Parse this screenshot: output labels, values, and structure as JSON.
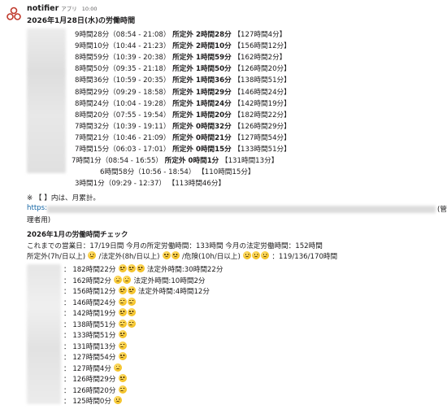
{
  "app": {
    "name": "notifier",
    "tag": "アプリ",
    "time": "10:00"
  },
  "message1": {
    "title": "2026年1月28日(水)の労働時間",
    "rows": [
      {
        "a": "9時間28分（08:54 - 21:08）",
        "b": "所定外 2時間28分",
        "c": "【127時間4分】"
      },
      {
        "a": "9時間10分（10:44 - 21:23）",
        "b": "所定外 2時間10分",
        "c": "【156時間12分】"
      },
      {
        "a": "8時間59分（10:39 - 20:38）",
        "b": "所定外 1時間59分",
        "c": "【162時間2分】"
      },
      {
        "a": "8時間50分（09:35 - 21:18）",
        "b": "所定外 1時間50分",
        "c": "【126時間20分】"
      },
      {
        "a": "8時間36分（10:59 - 20:35）",
        "b": "所定外 1時間36分",
        "c": "【138時間51分】"
      },
      {
        "a": "8時間29分（09:29 - 18:58）",
        "b": "所定外 1時間29分",
        "c": "【146時間24分】"
      },
      {
        "a": "8時間24分（10:04 - 19:28）",
        "b": "所定外 1時間24分",
        "c": "【142時間19分】"
      },
      {
        "a": "8時間20分（07:55 - 19:54）",
        "b": "所定外 1時間20分",
        "c": "【182時間22分】"
      },
      {
        "a": "7時間32分（10:39 - 19:11）",
        "b": "所定外 0時間32分",
        "c": "【126時間29分】"
      },
      {
        "a": "7時間21分（10:46 - 21:09）",
        "b": "所定外 0時間21分",
        "c": "【127時間54分】"
      },
      {
        "a": "7時間15分（06:03 - 17:01）",
        "b": "所定外 0時間15分",
        "c": "【133時間51分】"
      },
      {
        "a": "7時間1分（08:54 - 16:55）",
        "b": "所定外 0時間1分",
        "c": "【131時間13分】"
      },
      {
        "a": "6時間58分（10:56 - 18:54）",
        "b": "",
        "c": "【110時間15分】"
      },
      {
        "a": "3時間1分（09:29 - 12:37）",
        "b": "",
        "c": "【113時間46分】"
      }
    ],
    "note": "※ 【 】内は、月累計。",
    "link_prefix": "https:",
    "link_suffix": "(管",
    "link_line2": "理者用)"
  },
  "message2": {
    "title": "2026年1月の労働時間チェック",
    "summary1": "これまでの営業日：17/19日間 今月の所定労働時間：133時間 今月の法定労働時間：152時間",
    "summary2_a": "所定外(7h/日以上)",
    "summary2_b": "/法定外(8h/日以上)",
    "summary2_c": "/危険(10h/日以上)",
    "summary2_d": "：119/136/170時間",
    "rows": [
      {
        "hours": "182時間22分",
        "emoji": 3,
        "extra": "法定外時間:30時間22分"
      },
      {
        "hours": "162時間2分",
        "emoji": 2,
        "extra": "法定外時間:10時間2分"
      },
      {
        "hours": "156時間12分",
        "emoji": 2,
        "extra": "法定外時間:4時間12分"
      },
      {
        "hours": "146時間24分",
        "emoji": 2,
        "extra": ""
      },
      {
        "hours": "142時間19分",
        "emoji": 2,
        "extra": ""
      },
      {
        "hours": "138時間51分",
        "emoji": 2,
        "extra": ""
      },
      {
        "hours": "133時間51分",
        "emoji": 1,
        "extra": ""
      },
      {
        "hours": "131時間13分",
        "emoji": 1,
        "extra": ""
      },
      {
        "hours": "127時間54分",
        "emoji": 1,
        "extra": ""
      },
      {
        "hours": "127時間4分",
        "emoji": 1,
        "extra": ""
      },
      {
        "hours": "126時間29分",
        "emoji": 1,
        "extra": ""
      },
      {
        "hours": "126時間20分",
        "emoji": 1,
        "extra": ""
      },
      {
        "hours": "125時間0分",
        "emoji": 1,
        "extra": ""
      }
    ]
  }
}
